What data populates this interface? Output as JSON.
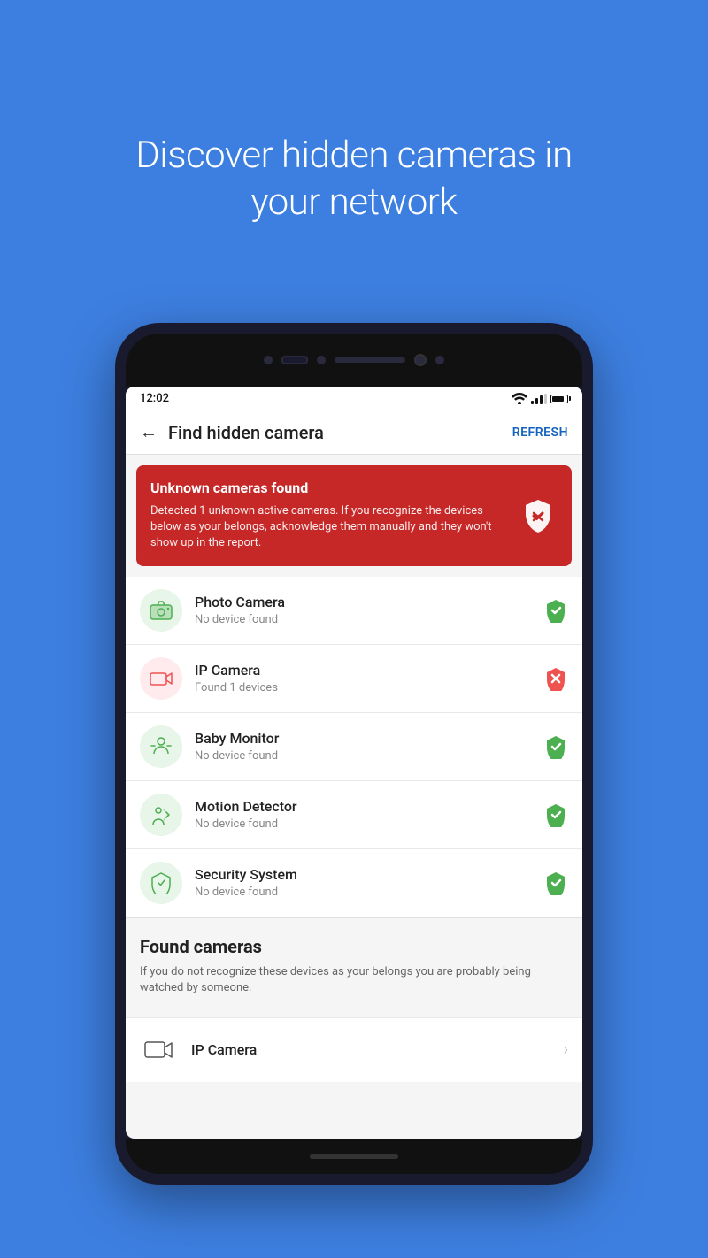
{
  "hero": {
    "title": "Discover hidden cameras in your network"
  },
  "statusBar": {
    "time": "12:02",
    "icons": [
      "wifi",
      "signal",
      "battery"
    ]
  },
  "appBar": {
    "backLabel": "←",
    "title": "Find hidden camera",
    "refreshLabel": "REFRESH"
  },
  "alert": {
    "title": "Unknown cameras found",
    "description": "Detected 1 unknown active cameras. If you recognize the devices below as your belongs, acknowledge them manually and they won't show up in the report."
  },
  "devices": [
    {
      "name": "Photo Camera",
      "status": "No device found",
      "iconType": "green",
      "iconGlyph": "📷",
      "statusType": "safe"
    },
    {
      "name": "IP Camera",
      "status": "Found 1 devices",
      "iconType": "red",
      "iconGlyph": "📹",
      "statusType": "danger"
    },
    {
      "name": "Baby Monitor",
      "status": "No device found",
      "iconType": "green",
      "iconGlyph": "⚖️",
      "statusType": "safe"
    },
    {
      "name": "Motion Detector",
      "status": "No device found",
      "iconType": "green",
      "iconGlyph": "🏃",
      "statusType": "safe"
    },
    {
      "name": "Security System",
      "status": "No device found",
      "iconType": "green",
      "iconGlyph": "🏠",
      "statusType": "safe"
    }
  ],
  "foundSection": {
    "title": "Found cameras",
    "description": "If you do not recognize these devices as your belongs you are probably being watched by someone.",
    "items": [
      {
        "name": "IP Camera",
        "iconGlyph": "📹"
      }
    ]
  }
}
